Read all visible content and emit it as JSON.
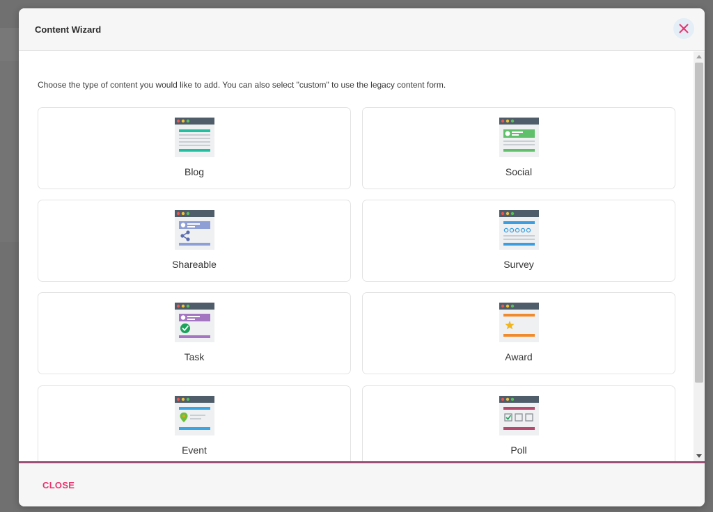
{
  "modal": {
    "title": "Content Wizard",
    "intro": "Choose the type of content you would like to add. You can also select \"custom\" to use the legacy content form.",
    "close_label": "CLOSE"
  },
  "cards": [
    {
      "label": "Blog",
      "icon": "blog-icon",
      "accent": "#1fbfa0"
    },
    {
      "label": "Social",
      "icon": "social-icon",
      "accent": "#5fbf6a"
    },
    {
      "label": "Shareable",
      "icon": "shareable-icon",
      "accent": "#8e9fd6"
    },
    {
      "label": "Survey",
      "icon": "survey-icon",
      "accent": "#3a9ee0"
    },
    {
      "label": "Task",
      "icon": "task-icon",
      "accent": "#a476c2"
    },
    {
      "label": "Award",
      "icon": "award-icon",
      "accent": "#f08a2a"
    },
    {
      "label": "Event",
      "icon": "event-icon",
      "accent": "#3aa5e2"
    },
    {
      "label": "Poll",
      "icon": "poll-icon",
      "accent": "#b54a6e"
    }
  ],
  "colors": {
    "close_accent": "#e8336f",
    "footer_line": "#9b4f74",
    "icon_titlebar": "#4f5d6b"
  }
}
